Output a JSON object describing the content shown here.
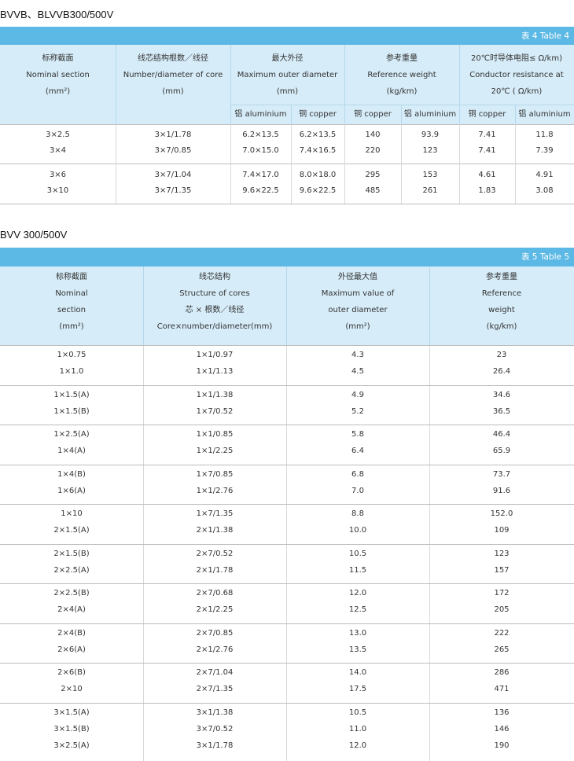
{
  "t4": {
    "section_title": "BVVB、BLVVB300/500V",
    "table_label": "表 4  Table 4",
    "headers": {
      "c1": [
        "标称截面",
        "Nominal section",
        "(mm²)"
      ],
      "c2": [
        "线芯结构根数／线径",
        "Number/diameter of core",
        "(mm)"
      ],
      "c3": [
        "最大外径",
        "Maximum outer diameter",
        "(mm)"
      ],
      "c4": [
        "参考重量",
        "Reference weight",
        "(kg/km)"
      ],
      "c5": [
        "20℃时导体电阻≤  Ω/km)",
        "Conductor resistance at",
        "20℃ ( Ω/km)"
      ],
      "sub": [
        "铝 aluminium",
        "铜 copper",
        "铜 copper",
        "铝 aluminium",
        "铜 copper",
        "铝 aluminium"
      ]
    },
    "groups": [
      [
        [
          "3×2.5",
          "3×1/1.78",
          "6.2×13.5",
          "6.2×13.5",
          "140",
          "93.9",
          "7.41",
          "11.8"
        ],
        [
          "3×4",
          "3×7/0.85",
          "7.0×15.0",
          "7.4×16.5",
          "220",
          "123",
          "7.41",
          "7.39"
        ]
      ],
      [
        [
          "3×6",
          "3×7/1.04",
          "7.4×17.0",
          "8.0×18.0",
          "295",
          "153",
          "4.61",
          "4.91"
        ],
        [
          "3×10",
          "3×7/1.35",
          "9.6×22.5",
          "9.6×22.5",
          "485",
          "261",
          "1.83",
          "3.08"
        ]
      ]
    ]
  },
  "t5": {
    "section_title": "BVV 300/500V",
    "table_label": "表 5  Table 5",
    "headers": {
      "c1": [
        "标称截面",
        "Nominal",
        "section",
        "(mm²)"
      ],
      "c2": [
        "线芯结构",
        "Structure of cores",
        "芯 × 根数／线径",
        "Core×number/diameter(mm)"
      ],
      "c3": [
        "外径最大值",
        "Maximum value of",
        "outer diameter",
        "(mm²)"
      ],
      "c4": [
        "参考重量",
        "Reference",
        "weight",
        "(kg/km)"
      ]
    },
    "groups": [
      [
        [
          "1×0.75",
          "1×1/0.97",
          "4.3",
          "23"
        ],
        [
          "1×1.0",
          "1×1/1.13",
          "4.5",
          "26.4"
        ]
      ],
      [
        [
          "1×1.5(A)",
          "1×1/1.38",
          "4.9",
          "34.6"
        ],
        [
          "1×1.5(B)",
          "1×7/0.52",
          "5.2",
          "36.5"
        ]
      ],
      [
        [
          "1×2.5(A)",
          "1×1/0.85",
          "5.8",
          "46.4"
        ],
        [
          "1×4(A)",
          "1×1/2.25",
          "6.4",
          "65.9"
        ]
      ],
      [
        [
          "1×4(B)",
          "1×7/0.85",
          "6.8",
          "73.7"
        ],
        [
          "1×6(A)",
          "1×1/2.76",
          "7.0",
          "91.6"
        ]
      ],
      [
        [
          "1×10",
          "1×7/1.35",
          "8.8",
          "152.0"
        ],
        [
          "2×1.5(A)",
          "2×1/1.38",
          "10.0",
          "109"
        ]
      ],
      [
        [
          "2×1.5(B)",
          "2×7/0.52",
          "10.5",
          "123"
        ],
        [
          "2×2.5(A)",
          "2×1/1.78",
          "11.5",
          "157"
        ]
      ],
      [
        [
          "2×2.5(B)",
          "2×7/0.68",
          "12.0",
          "172"
        ],
        [
          "2×4(A)",
          "2×1/2.25",
          "12.5",
          "205"
        ]
      ],
      [
        [
          "2×4(B)",
          "2×7/0.85",
          "13.0",
          "222"
        ],
        [
          "2×6(A)",
          "2×1/2.76",
          "13.5",
          "265"
        ]
      ],
      [
        [
          "2×6(B)",
          "2×7/1.04",
          "14.0",
          "286"
        ],
        [
          "2×10",
          "2×7/1.35",
          "17.5",
          "471"
        ]
      ],
      [
        [
          "3×1.5(A)",
          "3×1/1.38",
          "10.5",
          "136"
        ],
        [
          "3×1.5(B)",
          "3×7/0.52",
          "11.0",
          "146"
        ],
        [
          "3×2.5(A)",
          "3×1/1.78",
          "12.0",
          "190"
        ]
      ]
    ]
  }
}
